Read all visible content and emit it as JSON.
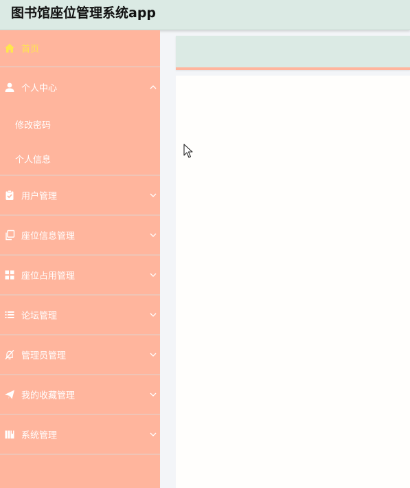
{
  "app": {
    "title": "图书馆座位管理系统app"
  },
  "colors": {
    "header_bg": "#dbeae4",
    "sidebar_bg": "#ffb59d",
    "active_text": "#ffe64d",
    "menu_text": "#ffffff",
    "content_bg": "#fffefc"
  },
  "sidebar": {
    "items": [
      {
        "label": "首页",
        "icon": "home-icon",
        "active": true
      },
      {
        "label": "个人中心",
        "icon": "user-icon",
        "expanded": true,
        "children": [
          {
            "label": "修改密码"
          },
          {
            "label": "个人信息"
          }
        ]
      },
      {
        "label": "用户管理",
        "icon": "clipboard-check-icon"
      },
      {
        "label": "座位信息管理",
        "icon": "copy-icon"
      },
      {
        "label": "座位占用管理",
        "icon": "grid-icon"
      },
      {
        "label": "论坛管理",
        "icon": "list-icon"
      },
      {
        "label": "管理员管理",
        "icon": "bell-off-icon"
      },
      {
        "label": "我的收藏管理",
        "icon": "send-icon"
      },
      {
        "label": "系统管理",
        "icon": "book-icon"
      }
    ]
  }
}
